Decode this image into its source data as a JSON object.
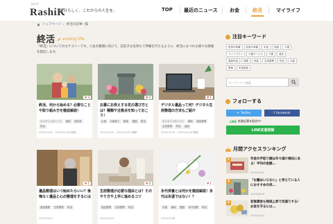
{
  "header": {
    "logo_text_main": "RashiK",
    "logo_sub": "ラシク",
    "tagline": "自分らしく、これからの人生を。",
    "nav": [
      {
        "label": "TOP"
      },
      {
        "label": "最近のニュース"
      },
      {
        "label": "お金"
      },
      {
        "label": "終活"
      },
      {
        "label": "マイライフ"
      }
    ],
    "active_nav": "終活"
  },
  "breadcrumb": {
    "home": "トップページ",
    "separator": "›",
    "current": "終活の記事一覧"
  },
  "page": {
    "title": "終活",
    "title_en": "ending life",
    "description": "「終活」についてのカテゴリーです。人生の最期に向けて、前向きな気持ちで準備を行えるように、終活にまつわる様々な情報を配信します。"
  },
  "articles": [
    {
      "title": "終活、何から始める？必要なことや取り組み方を徹底解説！",
      "likes": "4",
      "tags": [
        "エンディングノート",
        "相続",
        "遺言書",
        "終活"
      ],
      "date": "2021/01/25 〔2020/01/26 更新〕"
    },
    {
      "title": "お墓にお供えする花の選び方とは？種類や注意点を知っておこう！",
      "likes": "4",
      "tags": [
        "仏壇",
        "お墓参り",
        "墓地",
        "霊園",
        "終活"
      ],
      "date": "2020/12/24 〔2020/12/23 更新〕"
    },
    {
      "title": "デジタル遺品って何？デジタル生前整理の方法もご紹介",
      "likes": "1",
      "tags": [
        "エンディングノート",
        "相続",
        "遺品整理",
        "生前整理",
        "終活",
        "遺品"
      ],
      "date": "2020/12/18 〔2020/12/18 更新〕"
    },
    {
      "title": "遺品整理はいつ始めたらいい？後悔なく遺品と心の整理をするには",
      "likes": "1",
      "tags": [
        "遺品整理",
        "生前整理",
        "終活"
      ],
      "date": "2020/12/11"
    },
    {
      "title": "生前整理が必要な理由とは？そのやり方や上手に進めるコツ",
      "likes": "0",
      "tags": [
        "遺品整理",
        "生前整理",
        "終活"
      ],
      "date": "2020/12/10"
    },
    {
      "title": "永代供養とは何かを徹底解説！永代は永遠ではない！？",
      "likes": "1",
      "tags": [
        "お墓",
        "墓地",
        "霊園",
        "永代供養",
        "終活"
      ],
      "date": "2020/12/08"
    }
  ],
  "sidebar": {
    "keywords_title": "注目キーワード",
    "keywords": [
      "投資の準備",
      "老後の準備",
      "年金",
      "相続",
      "介護",
      "ライフプラン",
      "介護サービス",
      "介護",
      "遺言",
      "遺族年金",
      "保険",
      "税金",
      "生前整理",
      "終活",
      "お墓",
      "葬儀",
      "年金受給"
    ],
    "search_placeholder": "キーワードで検索",
    "follow_title": "フォローする",
    "twitter": "Twitter",
    "facebook": "facebook",
    "line_note_g": "LINE",
    "line_note": "新着記事を配信中！",
    "line_button": "LINE友達登録",
    "ranking_title": "月間アクセスランキング",
    "ranking": [
      {
        "num": "1",
        "title": "年金の手取り額は年々減少傾向にある！平均の金額...",
        "date": "2020/06/20"
      },
      {
        "num": "2",
        "title": "「お墓はいらない」と考えている人におすすめの供...",
        "date": "2020/06/09"
      },
      {
        "num": "3",
        "title": "老後資金も物価上昇で目減りする！お金を守るには...",
        "date": "2020/04/04"
      }
    ]
  },
  "colors": {
    "accent": "#e8a33b",
    "twitter": "#4aa1eb",
    "facebook": "#3b5998",
    "line": "#2bb24c"
  }
}
